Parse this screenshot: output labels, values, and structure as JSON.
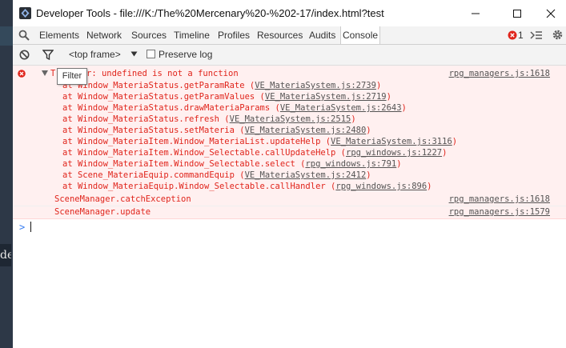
{
  "window": {
    "title": "Developer Tools - file:///K:/The%20Mercenary%20-%202-17/index.html?test"
  },
  "tabs": [
    {
      "label": "Elements"
    },
    {
      "label": "Network"
    },
    {
      "label": "Sources"
    },
    {
      "label": "Timeline"
    },
    {
      "label": "Profiles"
    },
    {
      "label": "Resources"
    },
    {
      "label": "Audits"
    },
    {
      "label": "Console"
    }
  ],
  "error_count": "1",
  "toolbar": {
    "frame_select": "<top frame>",
    "preserve_log_label": "Preserve log",
    "filter_tooltip": "Filter"
  },
  "console": {
    "error_message": "r: undefined is not a function",
    "error_prefix": "T",
    "error_source": "rpg_managers.js:1618",
    "stack": [
      {
        "text": "at Window_MateriaStatus.getParamRate (",
        "link": "VE_MateriaSystem.js:2739",
        "end": ")"
      },
      {
        "text": "at Window_MateriaStatus.getParamValues (",
        "link": "VE_MateriaSystem.js:2719",
        "end": ")"
      },
      {
        "text": "at Window_MateriaStatus.drawMateriaParams (",
        "link": "VE_MateriaSystem.js:2643",
        "end": ")"
      },
      {
        "text": "at Window_MateriaStatus.refresh (",
        "link": "VE_MateriaSystem.js:2515",
        "end": ")"
      },
      {
        "text": "at Window_MateriaStatus.setMateria (",
        "link": "VE_MateriaSystem.js:2480",
        "end": ")"
      },
      {
        "text": "at Window_MateriaItem.Window_MateriaList.updateHelp (",
        "link": "VE_MateriaSystem.js:3116",
        "end": ")"
      },
      {
        "text": "at Window_MateriaItem.Window_Selectable.callUpdateHelp (",
        "link": "rpg_windows.js:1227",
        "end": ")"
      },
      {
        "text": "at Window_MateriaItem.Window_Selectable.select (",
        "link": "rpg_windows.js:791",
        "end": ")"
      },
      {
        "text": "at Scene_MateriaEquip.commandEquip (",
        "link": "VE_MateriaSystem.js:2412",
        "end": ")"
      },
      {
        "text": "at Window_MateriaEquip.Window_Selectable.callHandler (",
        "link": "rpg_windows.js:896",
        "end": ")"
      }
    ],
    "log_lines": [
      {
        "text": "SceneManager.catchException",
        "source": "rpg_managers.js:1618"
      },
      {
        "text": "SceneManager.update",
        "source": "rpg_managers.js:1579"
      }
    ],
    "prompt": ">"
  },
  "background_text": "de",
  "colors": {
    "error_red": "#e0241b",
    "error_bg": "#fff0f0",
    "prompt_blue": "#367cf1",
    "desktop_bg": "#2d3847"
  }
}
